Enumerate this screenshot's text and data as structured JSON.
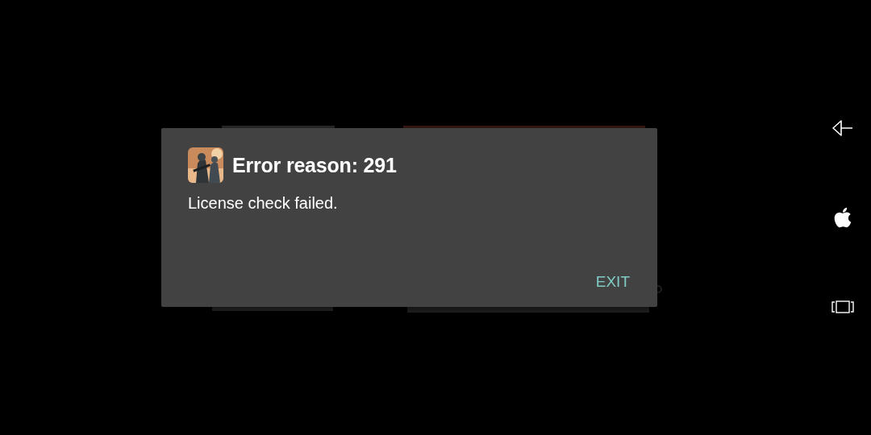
{
  "dialog": {
    "title": "Error reason: 291",
    "message": "License check failed.",
    "buttons": [
      {
        "label": "EXIT"
      }
    ]
  },
  "nav_bar": [
    {
      "kind": "back"
    },
    {
      "kind": "home"
    },
    {
      "kind": "recents"
    }
  ]
}
